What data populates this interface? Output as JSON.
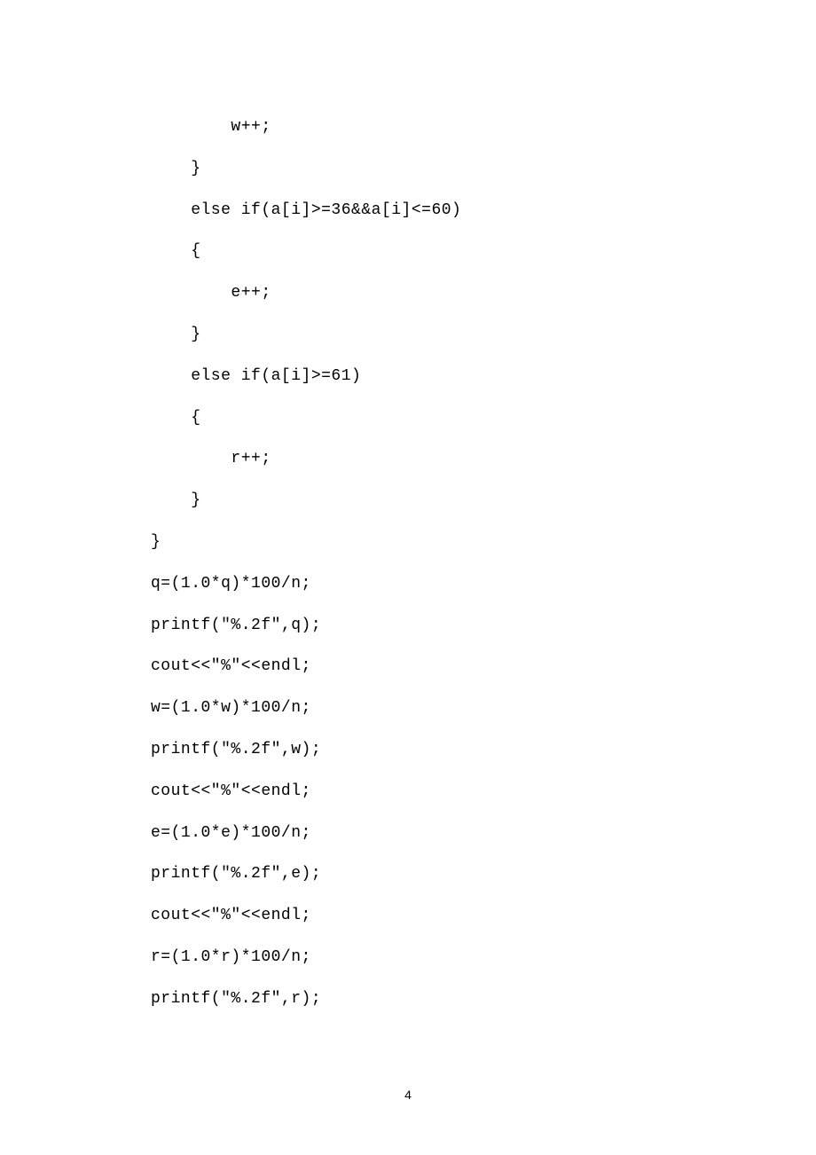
{
  "code_lines": [
    "        w++;",
    "    }",
    "    else if(a[i]>=36&&a[i]<=60)",
    "    {",
    "        e++;",
    "    }",
    "    else if(a[i]>=61)",
    "    {",
    "        r++;",
    "    }",
    "}",
    "q=(1.0*q)*100/n;",
    "printf(\"%.2f\",q);",
    "cout<<\"%\"<<endl;",
    "w=(1.0*w)*100/n;",
    "printf(\"%.2f\",w);",
    "cout<<\"%\"<<endl;",
    "e=(1.0*e)*100/n;",
    "printf(\"%.2f\",e);",
    "cout<<\"%\"<<endl;",
    "r=(1.0*r)*100/n;",
    "printf(\"%.2f\",r);"
  ],
  "page_number": "4"
}
